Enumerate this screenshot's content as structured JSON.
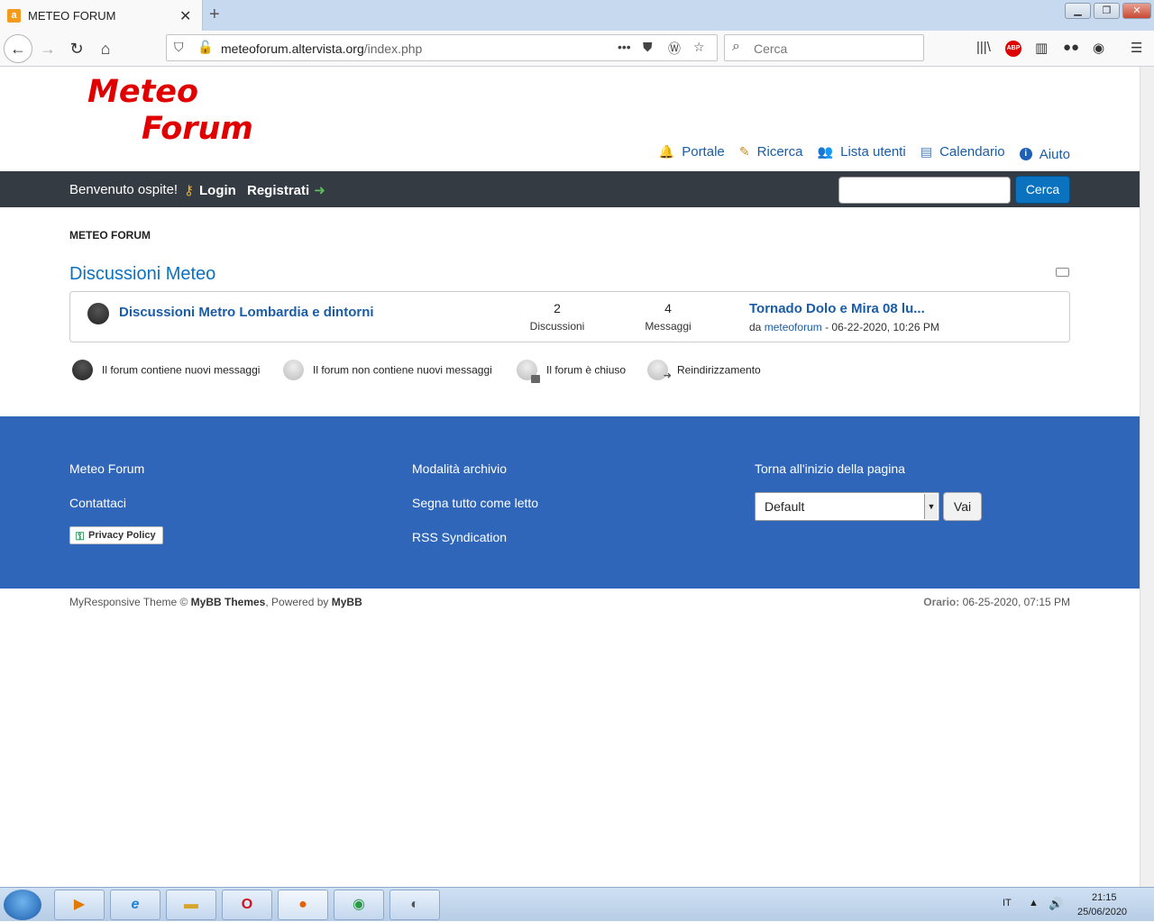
{
  "browser": {
    "tab_title": "METEO FORUM",
    "url_domain": "meteoforum.altervista.org",
    "url_path": "/index.php",
    "search_placeholder": "Cerca",
    "abp_label": "ABP"
  },
  "header": {
    "logo_line1": "Meteo",
    "logo_line2": "Forum",
    "toplinks": [
      "Portale",
      "Ricerca",
      "Lista utenti",
      "Calendario",
      "Aiuto"
    ]
  },
  "userbar": {
    "welcome": "Benvenuto ospite!",
    "login": "Login",
    "register": "Registrati",
    "search_button": "Cerca"
  },
  "breadcrumb": "METEO FORUM",
  "category": {
    "title": "Discussioni Meteo",
    "forum": {
      "name": "Discussioni Metro Lombardia e dintorni",
      "threads_count": "2",
      "threads_label": "Discussioni",
      "posts_count": "4",
      "posts_label": "Messaggi",
      "lastpost_title": "Tornado Dolo e Mira 08 lu...",
      "lastpost_by": "da",
      "lastpost_user": "meteoforum",
      "lastpost_date": "- 06-22-2020, 10:26 PM"
    }
  },
  "legend": [
    "Il forum contiene nuovi messaggi",
    "Il forum non contiene nuovi messaggi",
    "Il forum è chiuso",
    "Reindirizzamento"
  ],
  "footer": {
    "col1": [
      "Meteo Forum",
      "Contattaci"
    ],
    "privacy": "Privacy Policy",
    "col2": [
      "Modalità archivio",
      "Segna tutto come letto",
      "RSS Syndication"
    ],
    "top_link": "Torna all'inizio della pagina",
    "theme_selected": "Default",
    "go_button": "Vai"
  },
  "bottom": {
    "theme_prefix": "MyResponsive Theme © ",
    "theme_author": "MyBB Themes",
    "powered_prefix": ", Powered by ",
    "powered_by": "MyBB",
    "time_label": "Orario:",
    "time_value": " 06-25-2020, 07:15 PM"
  },
  "taskbar": {
    "lang": "IT",
    "time": "21:15",
    "date": "25/06/2020"
  }
}
